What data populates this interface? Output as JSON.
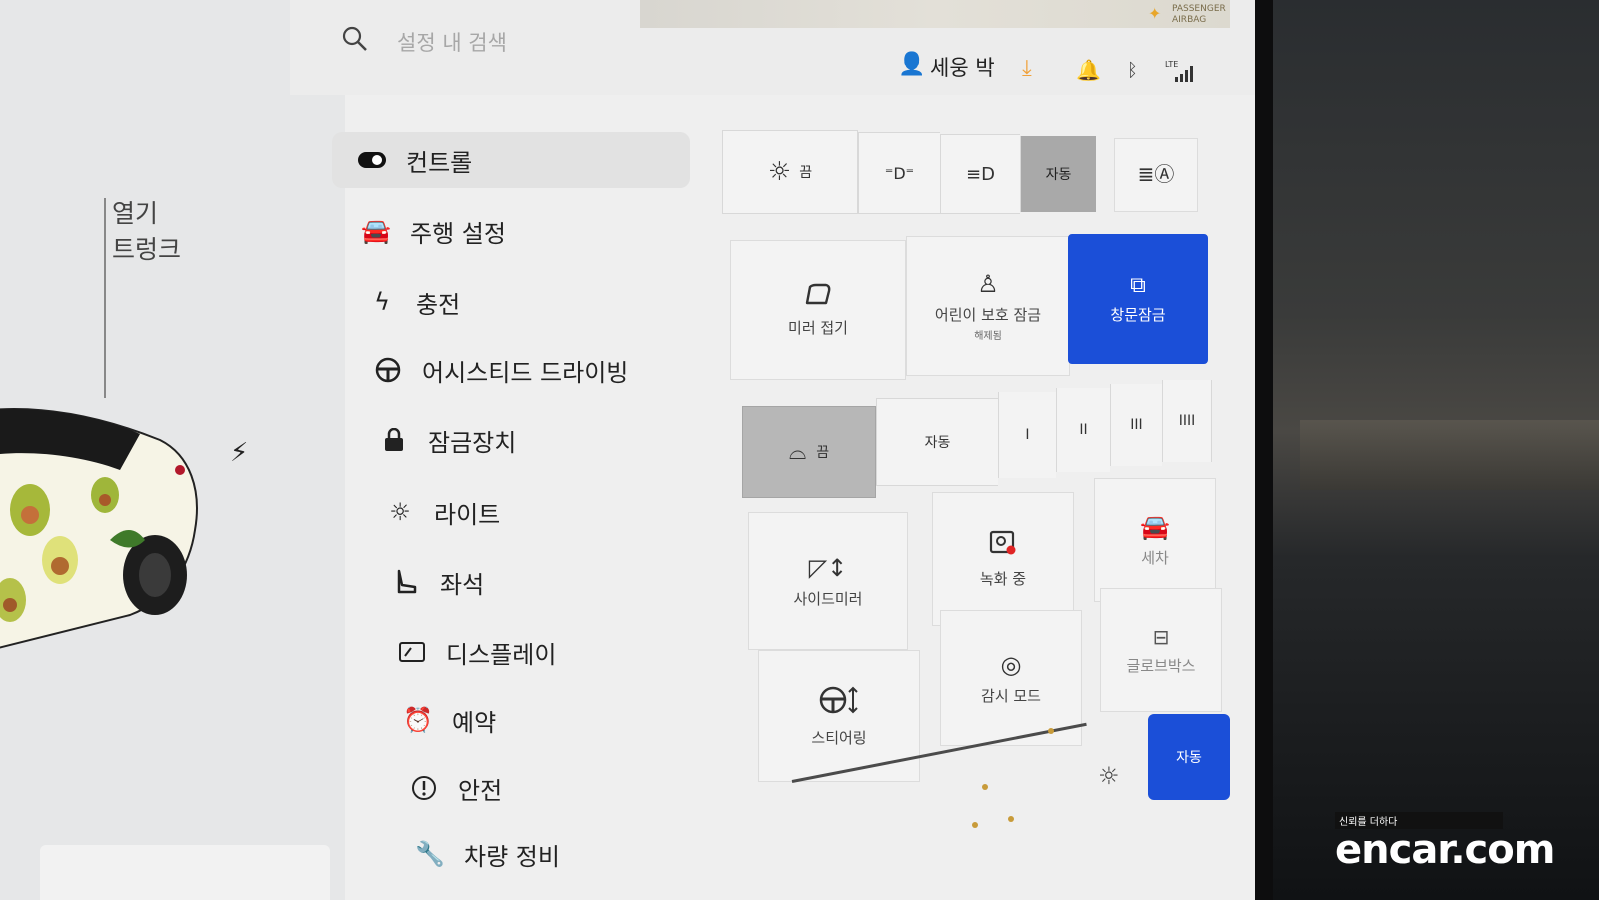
{
  "search": {
    "placeholder": "설정 내 검색"
  },
  "header": {
    "user_name": "세웅 박",
    "airbag_line1": "PASSENGER",
    "airbag_line2": "AIRBAG",
    "network": "LTE"
  },
  "car_panel": {
    "open_label": "열기",
    "trunk_label": "트렁크"
  },
  "menu": {
    "items": [
      {
        "label": "컨트롤",
        "icon": "toggle-icon"
      },
      {
        "label": "주행 설정",
        "icon": "car-icon"
      },
      {
        "label": "충전",
        "icon": "bolt-icon"
      },
      {
        "label": "어시스티드 드라이빙",
        "icon": "steering-wheel-icon"
      },
      {
        "label": "잠금장치",
        "icon": "lock-icon"
      },
      {
        "label": "라이트",
        "icon": "sun-icon"
      },
      {
        "label": "좌석",
        "icon": "seat-icon"
      },
      {
        "label": "디스플레이",
        "icon": "display-icon"
      },
      {
        "label": "예약",
        "icon": "alarm-clock-icon"
      },
      {
        "label": "안전",
        "icon": "warning-circle-icon"
      },
      {
        "label": "차량 정비",
        "icon": "wrench-icon"
      }
    ]
  },
  "lights": {
    "off_label": "끔",
    "auto_label": "자동",
    "selected": "자동"
  },
  "tiles": {
    "mirror_fold": "미러 접기",
    "child_lock": "어린이 보호 잠금",
    "child_lock_status": "해제됨",
    "window_lock": "창문잠금",
    "side_mirror": "사이드미러",
    "steering": "스티어링",
    "recording": "녹화 중",
    "sentry": "감시 모드",
    "car_wash": "세차",
    "glovebox": "글로브박스"
  },
  "wiper": {
    "off_label": "끔",
    "auto_label": "자동",
    "speeds": [
      "I",
      "II",
      "III",
      "IIII"
    ],
    "selected": "끔"
  },
  "brightness": {
    "auto_label": "자동"
  },
  "watermark": {
    "tagline": "신뢰를 더하다",
    "brand": "encar.com"
  },
  "colors": {
    "accent_blue": "#1b4fd8",
    "download_orange": "#f0a13a"
  }
}
